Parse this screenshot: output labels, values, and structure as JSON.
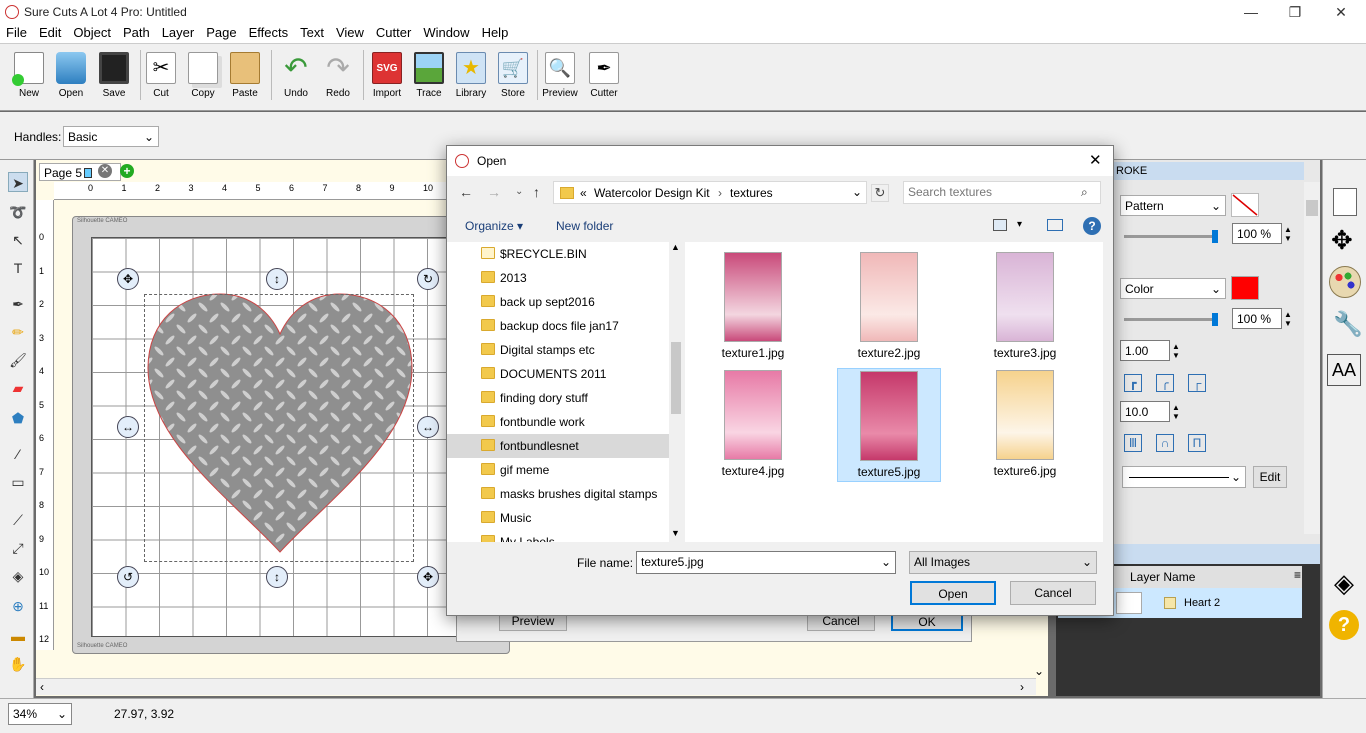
{
  "app": {
    "title": "Sure Cuts A Lot 4 Pro: Untitled"
  },
  "menu": [
    "File",
    "Edit",
    "Object",
    "Path",
    "Layer",
    "Page",
    "Effects",
    "Text",
    "View",
    "Cutter",
    "Window",
    "Help"
  ],
  "toolbar": [
    {
      "label": "New",
      "icon": "new-document-icon"
    },
    {
      "label": "Open",
      "icon": "open-folder-icon"
    },
    {
      "label": "Save",
      "icon": "save-disk-icon"
    },
    {
      "label": "Cut",
      "icon": "scissors-icon"
    },
    {
      "label": "Copy",
      "icon": "copy-icon"
    },
    {
      "label": "Paste",
      "icon": "paste-icon"
    },
    {
      "label": "Undo",
      "icon": "undo-arrow-icon"
    },
    {
      "label": "Redo",
      "icon": "redo-arrow-icon"
    },
    {
      "label": "Import",
      "icon": "svg-import-icon"
    },
    {
      "label": "Trace",
      "icon": "trace-image-icon"
    },
    {
      "label": "Library",
      "icon": "library-star-icon"
    },
    {
      "label": "Store",
      "icon": "cart-icon"
    },
    {
      "label": "Preview",
      "icon": "magnifier-icon"
    },
    {
      "label": "Cutter",
      "icon": "pen-cutter-icon"
    }
  ],
  "options": {
    "handles_label": "Handles:",
    "handles_value": "Basic"
  },
  "page_tab": {
    "label": "Page 5"
  },
  "ruler_top": [
    "0",
    "1",
    "2",
    "3",
    "4",
    "5",
    "6",
    "7",
    "8",
    "9",
    "10"
  ],
  "ruler_left": [
    "0",
    "1",
    "2",
    "3",
    "4",
    "5",
    "6",
    "7",
    "8",
    "9",
    "10",
    "11",
    "12"
  ],
  "mat_label": "Silhouette CAMEO",
  "behind_dialog": {
    "preview": "Preview",
    "cancel": "Cancel",
    "ok": "OK"
  },
  "right_panel": {
    "header": "ROKE",
    "pattern_select": "Pattern",
    "opacity1": "100 %",
    "color_select": "Color",
    "color_swatch": "#ff0000",
    "opacity2": "100 %",
    "stroke_width": "1.00",
    "miter": "10.0",
    "edit_btn": "Edit",
    "layers_header": "Layer Name",
    "layer_name": "Heart 2"
  },
  "status": {
    "zoom": "34%",
    "coords": "27.97, 3.92"
  },
  "dialog": {
    "title": "Open",
    "path": [
      "«",
      "Watercolor Design Kit",
      "textures"
    ],
    "search_placeholder": "Search textures",
    "organize": "Organize ▾",
    "new_folder": "New folder",
    "folders": [
      "$RECYCLE.BIN",
      "2013",
      "back up sept2016",
      "backup docs file jan17",
      "Digital stamps etc",
      "DOCUMENTS 2011",
      "finding dory stuff",
      "fontbundle work",
      "fontbundlesnet",
      "gif meme",
      "masks brushes digital stamps",
      "Music",
      "My Labels"
    ],
    "selected_folder_index": 8,
    "files": [
      {
        "name": "texture1.jpg",
        "c1": "#c94a7a",
        "c2": "#f3d6e0"
      },
      {
        "name": "texture2.jpg",
        "c1": "#f0b8b8",
        "c2": "#fbe9e6"
      },
      {
        "name": "texture3.jpg",
        "c1": "#d9b4d6",
        "c2": "#efe0ef"
      },
      {
        "name": "texture4.jpg",
        "c1": "#e77aa6",
        "c2": "#f9d5e3"
      },
      {
        "name": "texture5.jpg",
        "c1": "#c5386a",
        "c2": "#e98aa9"
      },
      {
        "name": "texture6.jpg",
        "c1": "#f6d28d",
        "c2": "#fdf5e8"
      }
    ],
    "selected_file_index": 4,
    "filename_label": "File name:",
    "filename_value": "texture5.jpg",
    "filetype": "All Images",
    "open_btn": "Open",
    "cancel_btn": "Cancel"
  },
  "colors": {
    "accent": "#0078d7",
    "selection": "#cce8ff",
    "heart": "#8f8f8f"
  }
}
